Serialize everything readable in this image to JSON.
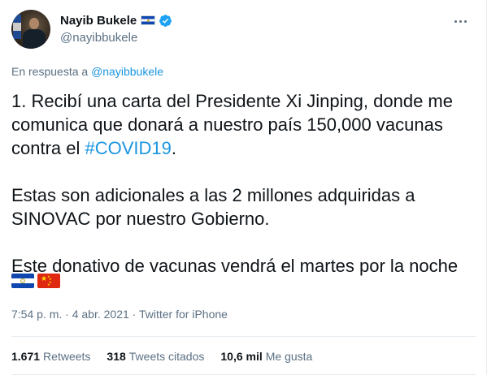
{
  "author": {
    "display_name": "Nayib Bukele",
    "handle": "@nayibbukele",
    "flag_icon": "el-salvador-flag-icon",
    "verified_icon": "verified-badge-icon"
  },
  "reply": {
    "prefix": "En respuesta a",
    "mention": "@nayibbukele"
  },
  "tweet": {
    "line1": "1. Recibí una carta del Presidente Xi Jinping, donde me",
    "line2": "comunica que donará a nuestro país 150,000 vacunas",
    "line3_prefix": "contra el ",
    "hashtag": "#COVID19",
    "line3_suffix": ".",
    "para2_line1": "Estas son adicionales a las 2 millones adquiridas a",
    "para2_line2": "SINOVAC por nuestro Gobierno.",
    "para3": "Este donativo de vacunas vendrá el martes por la noche",
    "emoji": [
      "el-salvador-flag-emoji",
      "china-flag-emoji"
    ]
  },
  "meta": {
    "time": "7:54 p. m.",
    "separator": " · ",
    "date": "4 abr. 2021",
    "source": "Twitter for iPhone"
  },
  "stats": [
    {
      "count": "1.671",
      "label": "Retweets"
    },
    {
      "count": "318",
      "label": "Tweets citados"
    },
    {
      "count": "10,6 mil",
      "label": "Me gusta"
    }
  ],
  "colors": {
    "link": "#1b95e0",
    "secondary_text": "#5b7083",
    "primary_text": "#0f1419",
    "divider": "#e6ecf0"
  }
}
